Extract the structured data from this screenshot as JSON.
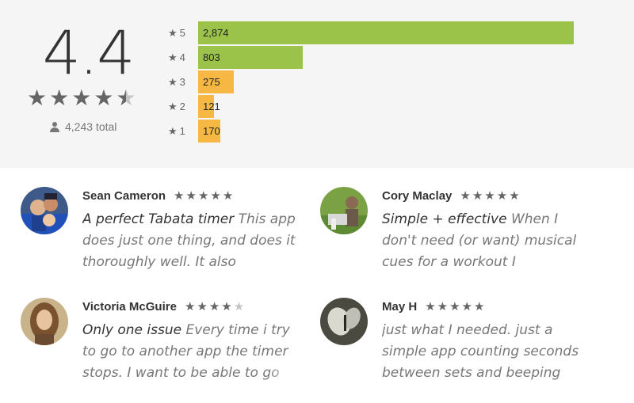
{
  "rating": {
    "score": "4.4",
    "stars_value": 4.5,
    "total": "4,243 total"
  },
  "histogram": [
    {
      "stars": "5",
      "count": "2,874",
      "value": 2874,
      "color": "#9bc34a"
    },
    {
      "stars": "4",
      "count": "803",
      "value": 803,
      "color": "#9bc34a"
    },
    {
      "stars": "3",
      "count": "275",
      "value": 275,
      "color": "#f7b843"
    },
    {
      "stars": "2",
      "count": "121",
      "value": 121,
      "color": "#f7b843"
    },
    {
      "stars": "1",
      "count": "170",
      "value": 170,
      "color": "#f7b843"
    }
  ],
  "reviews": [
    {
      "name": "Sean Cameron",
      "rating": 5,
      "title": "A perfect Tabata timer",
      "body": "This app does just one thing, and does it thoroughly well. It also"
    },
    {
      "name": "Cory Maclay",
      "rating": 5,
      "title": "Simple + effective",
      "body": "When I don't need (or want) musical cues for a workout I consistently turn to"
    },
    {
      "name": "Victoria McGuire",
      "rating": 4,
      "title": "Only one issue",
      "body": "Every time i try to go to another app the timer stops. I want to be able to go"
    },
    {
      "name": "May H",
      "rating": 5,
      "title": "",
      "body": "just what I needed. just a simple app counting seconds between sets and beeping"
    }
  ],
  "star_glyph": "★"
}
